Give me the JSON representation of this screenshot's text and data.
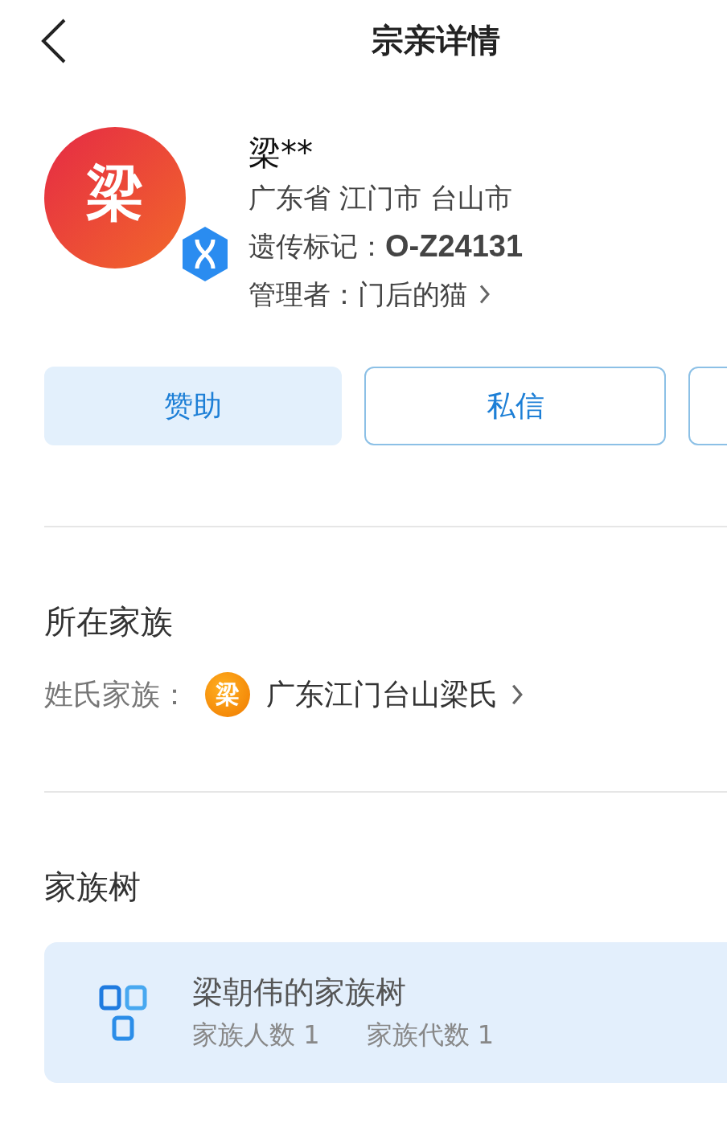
{
  "header": {
    "title": "宗亲详情"
  },
  "profile": {
    "avatar_char": "梁",
    "name": "梁**",
    "location": "广东省 江门市 台山市",
    "marker_label": "遗传标记：",
    "marker_value": "O-Z24131",
    "manager_label": "管理者：",
    "manager_name": "门后的猫"
  },
  "actions": [
    {
      "label": "赞助",
      "kind": "filled"
    },
    {
      "label": "私信",
      "kind": "outlined"
    },
    {
      "kind": "partial"
    }
  ],
  "family_section": {
    "title": "所在家族",
    "label": "姓氏家族：",
    "badge_char": "梁",
    "family_name": "广东江门台山梁氏"
  },
  "tree_section": {
    "title": "家族树",
    "card": {
      "title": "梁朝伟的家族树",
      "stats": [
        {
          "label": "家族人数",
          "value": "1"
        },
        {
          "label": "家族代数",
          "value": "1"
        }
      ]
    }
  }
}
